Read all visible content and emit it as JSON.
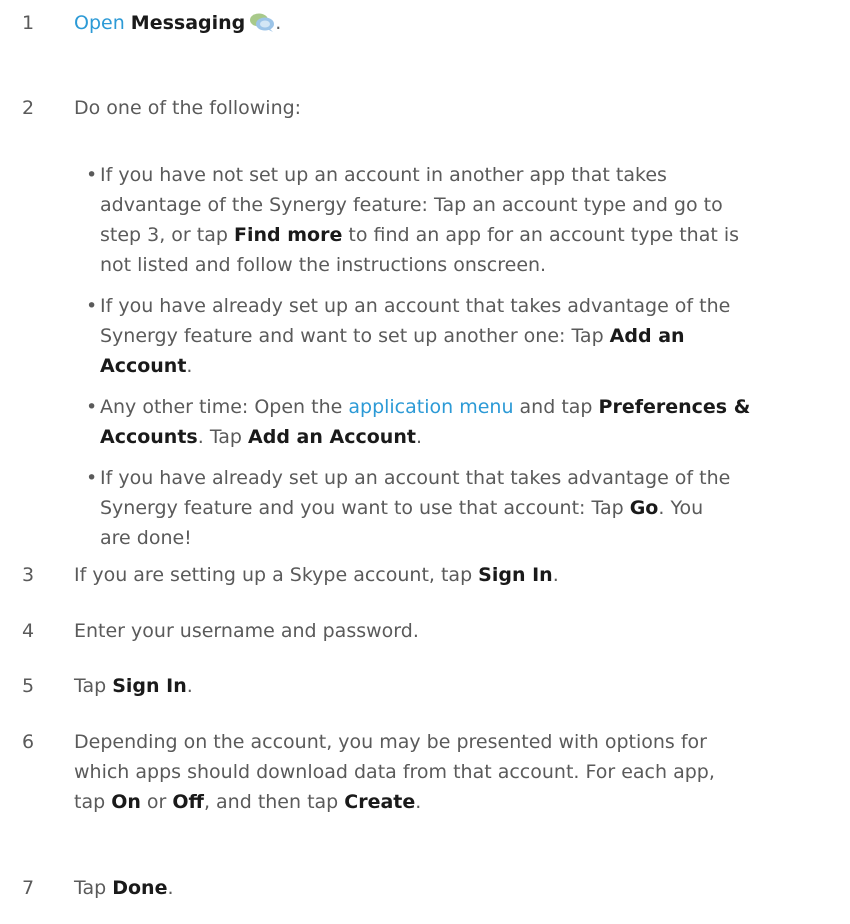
{
  "steps": [
    {
      "num": "1",
      "open": "Open",
      "messaging": "Messaging",
      "icon": "messaging-icon",
      "end": "."
    },
    {
      "num": "2",
      "text": "Do one of the following:"
    },
    {
      "num": "3",
      "pre": "If you are setting up a Skype account, tap ",
      "bold": "Sign In",
      "end": "."
    },
    {
      "num": "4",
      "text": "Enter your username and password."
    },
    {
      "num": "5",
      "pre": "Tap ",
      "bold": "Sign In",
      "end": "."
    },
    {
      "num": "6",
      "l1": "Depending on the account, you may be presented with options for",
      "l2": "which apps should download data from that account. For each app,",
      "l3_pre": "tap ",
      "on": "On",
      "or": " or ",
      "off": "Off",
      "mid": ", and then tap ",
      "create": "Create",
      "end": "."
    },
    {
      "num": "7",
      "pre": "Tap ",
      "bold": "Done",
      "end": "."
    }
  ],
  "bullets": {
    "b1": {
      "l1": "If you have not set up an account in another app that takes",
      "l2": "advantage of the Synergy feature: Tap an account type and go to",
      "l3_pre": "step 3, or tap ",
      "l3_bold": "Find more",
      "l3_post": " to find an app for an account type that is",
      "l4": "not listed and follow the instructions onscreen."
    },
    "b2": {
      "l1": "If you have already set up an account that takes advantage of the",
      "l2_pre": "Synergy feature and want to set up another one: Tap ",
      "l2_bold": "Add an",
      "l3_bold": "Account",
      "l3_post": "."
    },
    "b3": {
      "l1_pre": "Any other time: Open the ",
      "l1_link": "application menu",
      "l1_mid": " and tap ",
      "l1_bold": "Preferences &",
      "l2_bold": "Accounts",
      "l2_mid": ". Tap ",
      "l2_bold2": "Add an Account",
      "l2_post": "."
    },
    "b4": {
      "l1": "If you have already set up an account that takes advantage of the",
      "l2_pre": "Synergy feature and you want to use that account: Tap ",
      "l2_bold": "Go",
      "l2_post": ". You",
      "l3": "are done!"
    }
  },
  "colors": {
    "text": "#5a5a5a",
    "bold": "#1a1a1a",
    "link": "#2c9ad6"
  }
}
